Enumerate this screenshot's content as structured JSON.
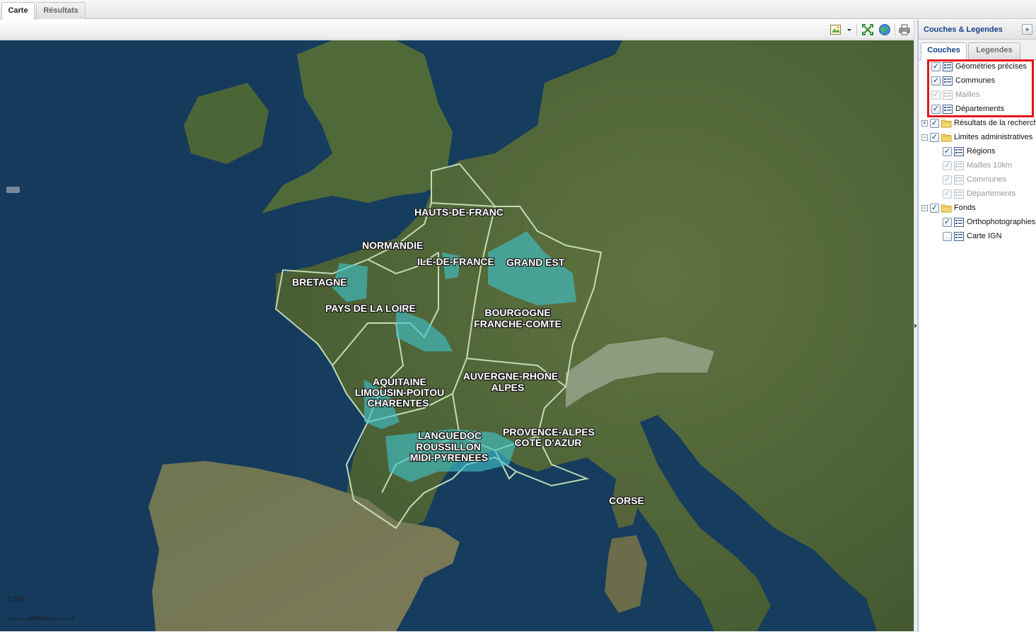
{
  "main_tabs": [
    {
      "label": "Carte",
      "active": true
    },
    {
      "label": "Résultats",
      "active": false
    }
  ],
  "toolbar": {
    "icons": [
      "legend-map-icon",
      "dropdown-arrow-icon",
      "zoom-extent-icon",
      "globe-icon",
      "print-icon"
    ]
  },
  "map": {
    "scale_label": "1:9M",
    "scale_bar_label": "200 km",
    "regions": [
      {
        "name": "HAUTS-DE-FRANC"
      },
      {
        "name": "NORMANDIE"
      },
      {
        "name": "ILE-DE-FRANCE"
      },
      {
        "name": "GRAND EST"
      },
      {
        "name": "BRETAGNE"
      },
      {
        "name": "PAYS DE LA LOIRE"
      },
      {
        "name": "BOURGOGNE"
      },
      {
        "name": "FRANCHE-COMTE"
      },
      {
        "name": "AUVERGNE-RHONE"
      },
      {
        "name": "ALPES"
      },
      {
        "name": "AQUITAINE"
      },
      {
        "name": "LIMOUSIN-POITOU"
      },
      {
        "name": "CHARENTES"
      },
      {
        "name": "LANGUEDOC"
      },
      {
        "name": "ROUSSILLON"
      },
      {
        "name": "MIDI-PYRENEES"
      },
      {
        "name": "PROVENCE-ALPES"
      },
      {
        "name": "COTE D'AZUR"
      },
      {
        "name": "CORSE"
      }
    ],
    "colors": {
      "sea": "#163c5e",
      "land": "#52663a",
      "highlight": "#3fc3cc",
      "region_border": "#cfe9c2"
    }
  },
  "side_panel": {
    "title": "Couches & Legendes",
    "collapse_label": "»",
    "tabs": [
      {
        "label": "Couches",
        "active": true
      },
      {
        "label": "Legendes",
        "active": false
      }
    ],
    "tree": [
      {
        "label": "Géométries précises",
        "checked": true,
        "disabled": false,
        "type": "layer",
        "depth": 1
      },
      {
        "label": "Communes",
        "checked": true,
        "disabled": false,
        "type": "layer",
        "depth": 1
      },
      {
        "label": "Mailles",
        "checked": true,
        "disabled": true,
        "type": "layer",
        "depth": 1
      },
      {
        "label": "Départements",
        "checked": true,
        "disabled": false,
        "type": "layer",
        "depth": 1
      },
      {
        "label": "Résultats de la recherche",
        "checked": true,
        "disabled": false,
        "type": "folder",
        "depth": 0,
        "expand": "+"
      },
      {
        "label": "Limites administratives",
        "checked": true,
        "disabled": false,
        "type": "folder",
        "depth": 0,
        "expand": "−"
      },
      {
        "label": "Régions",
        "checked": true,
        "disabled": false,
        "type": "layer",
        "depth": 2
      },
      {
        "label": "Mailles 10km",
        "checked": true,
        "disabled": true,
        "type": "layer",
        "depth": 2
      },
      {
        "label": "Communes",
        "checked": true,
        "disabled": true,
        "type": "layer",
        "depth": 2
      },
      {
        "label": "Départements",
        "checked": true,
        "disabled": true,
        "type": "layer",
        "depth": 2
      },
      {
        "label": "Fonds",
        "checked": true,
        "disabled": false,
        "type": "folder",
        "depth": 0,
        "expand": "−"
      },
      {
        "label": "Orthophotographies",
        "checked": true,
        "disabled": false,
        "type": "layer",
        "depth": 2
      },
      {
        "label": "Carte IGN",
        "checked": false,
        "disabled": false,
        "type": "layer",
        "depth": 2
      }
    ]
  }
}
